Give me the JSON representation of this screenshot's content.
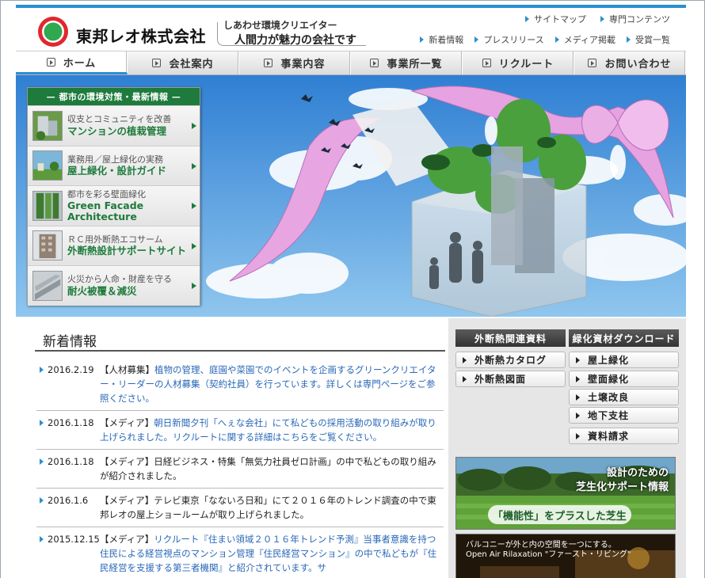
{
  "header": {
    "company_name": "東邦レオ株式会社",
    "tagline_small": "しあわせ環境クリエイター",
    "tagline_main": "人間力が魅力の会社です",
    "top_links": [
      "サイトマップ",
      "専門コンテンツ"
    ],
    "sub_links": [
      "新着情報",
      "プレスリリース",
      "メディア掲載",
      "受賞一覧"
    ]
  },
  "nav": {
    "items": [
      "ホーム",
      "会社案内",
      "事業内容",
      "事業所一覧",
      "リクルート",
      "お問い合わせ"
    ],
    "active_index": 0
  },
  "env_panel": {
    "heading": "— 都市の環境対策・最新情報 —",
    "items": [
      {
        "sub": "収支とコミュニティを改善",
        "title": "マンションの植栽管理"
      },
      {
        "sub": "業務用／屋上緑化の実務",
        "title": "屋上緑化・設計ガイド"
      },
      {
        "sub": "都市を彩る壁面緑化",
        "title": "Green Facade Architecture"
      },
      {
        "sub": "ＲＣ用外断熱エコサーム",
        "title": "外断熱設計サポートサイト"
      },
      {
        "sub": "火災から人命・財産を守る",
        "title": "耐火被覆＆減災"
      }
    ]
  },
  "news": {
    "title": "新着情報",
    "items": [
      {
        "date": "2016.2.19",
        "category": "【人材募集】",
        "text": "植物の管理、庭園や菜園でのイベントを企画するグリーンクリエイター・リーダーの人材募集（契約社員）を行っています。詳しくは専門ページをご参照ください。"
      },
      {
        "date": "2016.1.18",
        "category": "【メディア】",
        "text": "朝日新聞夕刊「へぇな会社」にて私どもの採用活動の取り組みが取り上げられました。リクルートに関する詳細はこちらをご覧ください。"
      },
      {
        "date": "2016.1.18",
        "category": "【メディア】",
        "text": "日経ビジネス・特集「無気力社員ゼロ計画」の中で私どもの取り組みが紹介されました。"
      },
      {
        "date": "2016.1.6",
        "category": "【メディア】",
        "text": "テレビ東京「なないろ日和」にて２０１６年のトレンド調査の中で東邦レオの屋上ショールームが取り上げられました。"
      },
      {
        "date": "2015.12.15",
        "category": "【メディア】",
        "text": "リクルート『住まい領域２０１６年トレンド予測』当事者意識を持つ住民による経営視点のマンション管理『住民経営マンション』の中で私どもが『住民経営を支援する第三者機関』と紹介されています。サ"
      }
    ]
  },
  "downloads": {
    "insulation_head": "外断熱関連資料",
    "insulation_items": [
      "外断熱カタログ",
      "外断熱図面"
    ],
    "greening_head": "緑化資材ダウンロード",
    "greening_items": [
      "屋上緑化",
      "壁面緑化",
      "土壌改良",
      "地下支柱"
    ],
    "request_label": "資料請求"
  },
  "banners": {
    "turf_line1": "設計のための",
    "turf_line2": "芝生化サポート情報",
    "turf_tag": "「機能性」をプラスした芝生",
    "balcony_line1": "バルコニーが外と内の空間を一つにする。",
    "balcony_line2": "Open Air Rilaxation \"ファースト・リビング\""
  },
  "colors": {
    "accent_blue": "#2a8fd0",
    "brand_green": "#1e7b3c",
    "link_blue": "#2a68b8"
  }
}
